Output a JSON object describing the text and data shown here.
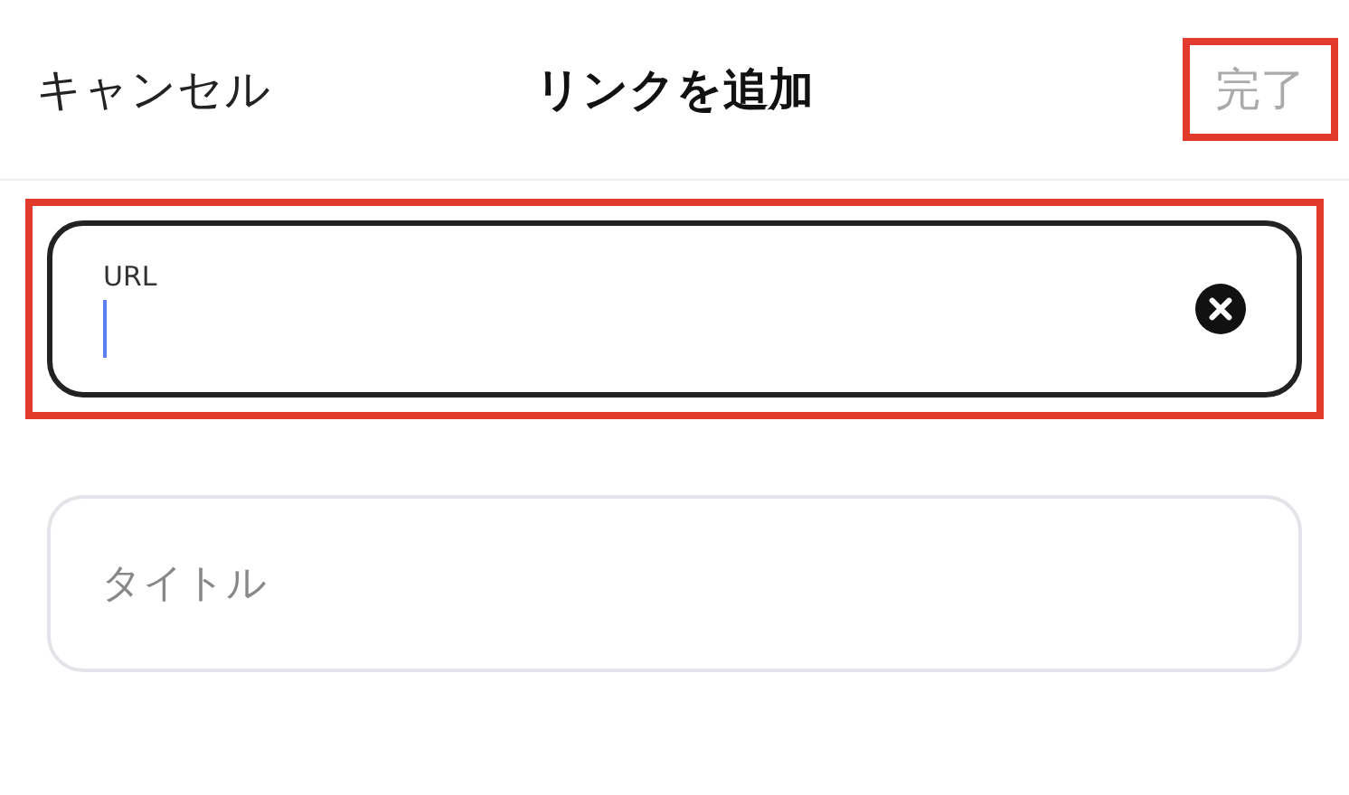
{
  "header": {
    "cancel": "キャンセル",
    "title": "リンクを追加",
    "done": {
      "label": "完了",
      "disabled": true,
      "highlighted": true
    }
  },
  "fields": [
    {
      "label": "URL",
      "focused": true,
      "highlighted": true
    },
    {
      "placeholder": "タイトル",
      "focused": false,
      "highlighted": false
    }
  ]
}
